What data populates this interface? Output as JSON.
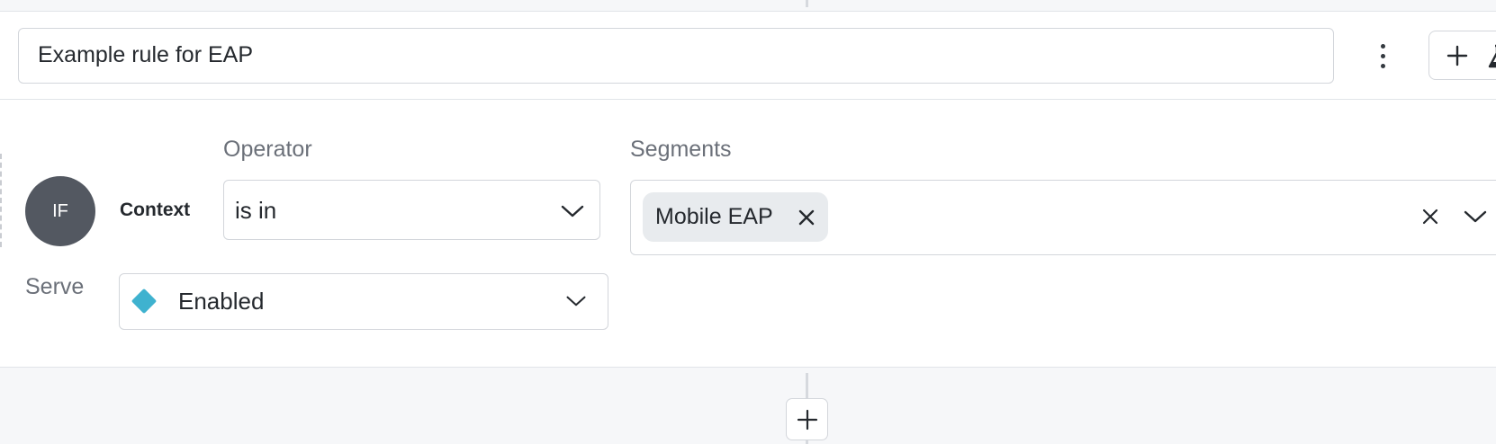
{
  "rule": {
    "name_value": "Example rule for EAP",
    "condition_badge": "IF",
    "attribute_label": "Context",
    "operator": {
      "label": "Operator",
      "value": "is in"
    },
    "segments": {
      "label": "Segments",
      "selected": [
        "Mobile EAP"
      ]
    },
    "serve": {
      "label": "Serve",
      "value": "Enabled",
      "variation_color": "#3fb2cf"
    }
  },
  "icons": {
    "kebab": "more-vertical-icon",
    "add": "plus-icon",
    "flask": "flask-icon",
    "chevron": "chevron-down-icon",
    "close": "close-icon"
  }
}
